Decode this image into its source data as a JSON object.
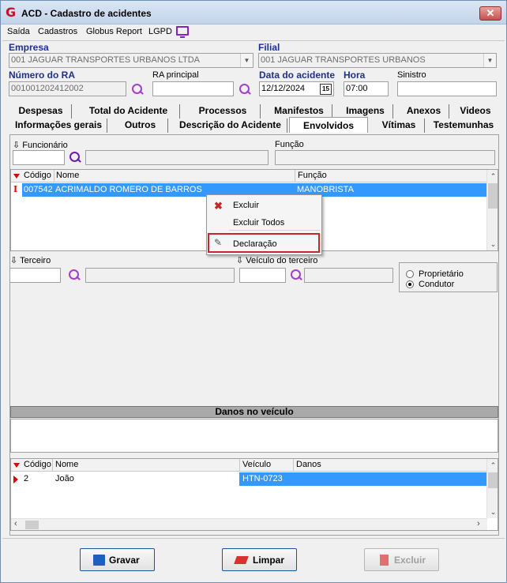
{
  "window": {
    "title": "ACD - Cadastro de acidentes",
    "close_glyph": "✕",
    "logo": "G"
  },
  "menu": [
    "Saída",
    "Cadastros",
    "Globus Report",
    "LGPD"
  ],
  "empresa": {
    "label": "Empresa",
    "value": "001 JAGUAR TRANSPORTES URBANOS LTDA"
  },
  "filial": {
    "label": "Filial",
    "value": "001 JAGUAR TRANSPORTES URBANOS"
  },
  "numero_ra": {
    "label": "Número do RA",
    "value": "001001202412002"
  },
  "ra_principal": {
    "label": "RA principal",
    "value": ""
  },
  "data_acidente": {
    "label": "Data do acidente",
    "value": "12/12/2024",
    "cal_icon": "15"
  },
  "hora": {
    "label": "Hora",
    "value": "07:00"
  },
  "sinistro": {
    "label": "Sinistro",
    "value": ""
  },
  "tabs_row1": [
    "Despesas",
    "Total do Acidente",
    "Processos",
    "Manifestos",
    "Imagens",
    "Anexos",
    "Videos"
  ],
  "tabs_row2": [
    "Informações gerais",
    "Outros",
    "Descrição do Acidente",
    "Envolvidos",
    "Vítimas",
    "Testemunhas"
  ],
  "active_tab": "Envolvidos",
  "funcionario": {
    "label": "Funcionário",
    "code": "",
    "name": "",
    "funcao_label": "Função",
    "funcao": ""
  },
  "grid_func": {
    "headers": [
      "Código",
      "Nome",
      "Função"
    ],
    "rows": [
      {
        "codigo": "007542",
        "nome": "ACRIMALDO ROMERO DE BARROS",
        "funcao": "MANOBRISTA"
      }
    ]
  },
  "context_menu": {
    "items": [
      "Excluir",
      "Excluir Todos",
      "Declaração"
    ],
    "highlight_color": "#c62828"
  },
  "terceiro": {
    "label": "Terceiro",
    "code": "",
    "name": ""
  },
  "veiculo_terceiro": {
    "label": "Veículo do terceiro",
    "code": "",
    "name": ""
  },
  "radio": {
    "options": [
      "Proprietário",
      "Condutor"
    ],
    "selected": "Condutor"
  },
  "danos": {
    "title": "Danos no veículo",
    "text": ""
  },
  "grid_danos": {
    "headers": [
      "Código",
      "Nome",
      "Veículo",
      "Danos"
    ],
    "rows": [
      {
        "codigo": "2",
        "nome": "João",
        "veiculo": "HTN-0723",
        "danos": ""
      }
    ]
  },
  "buttons": {
    "gravar": "Gravar",
    "limpar": "Limpar",
    "excluir": "Excluir"
  },
  "colors": {
    "accent": "#1f2f8f",
    "selection": "#3399ff",
    "search": "#a23fc9"
  }
}
